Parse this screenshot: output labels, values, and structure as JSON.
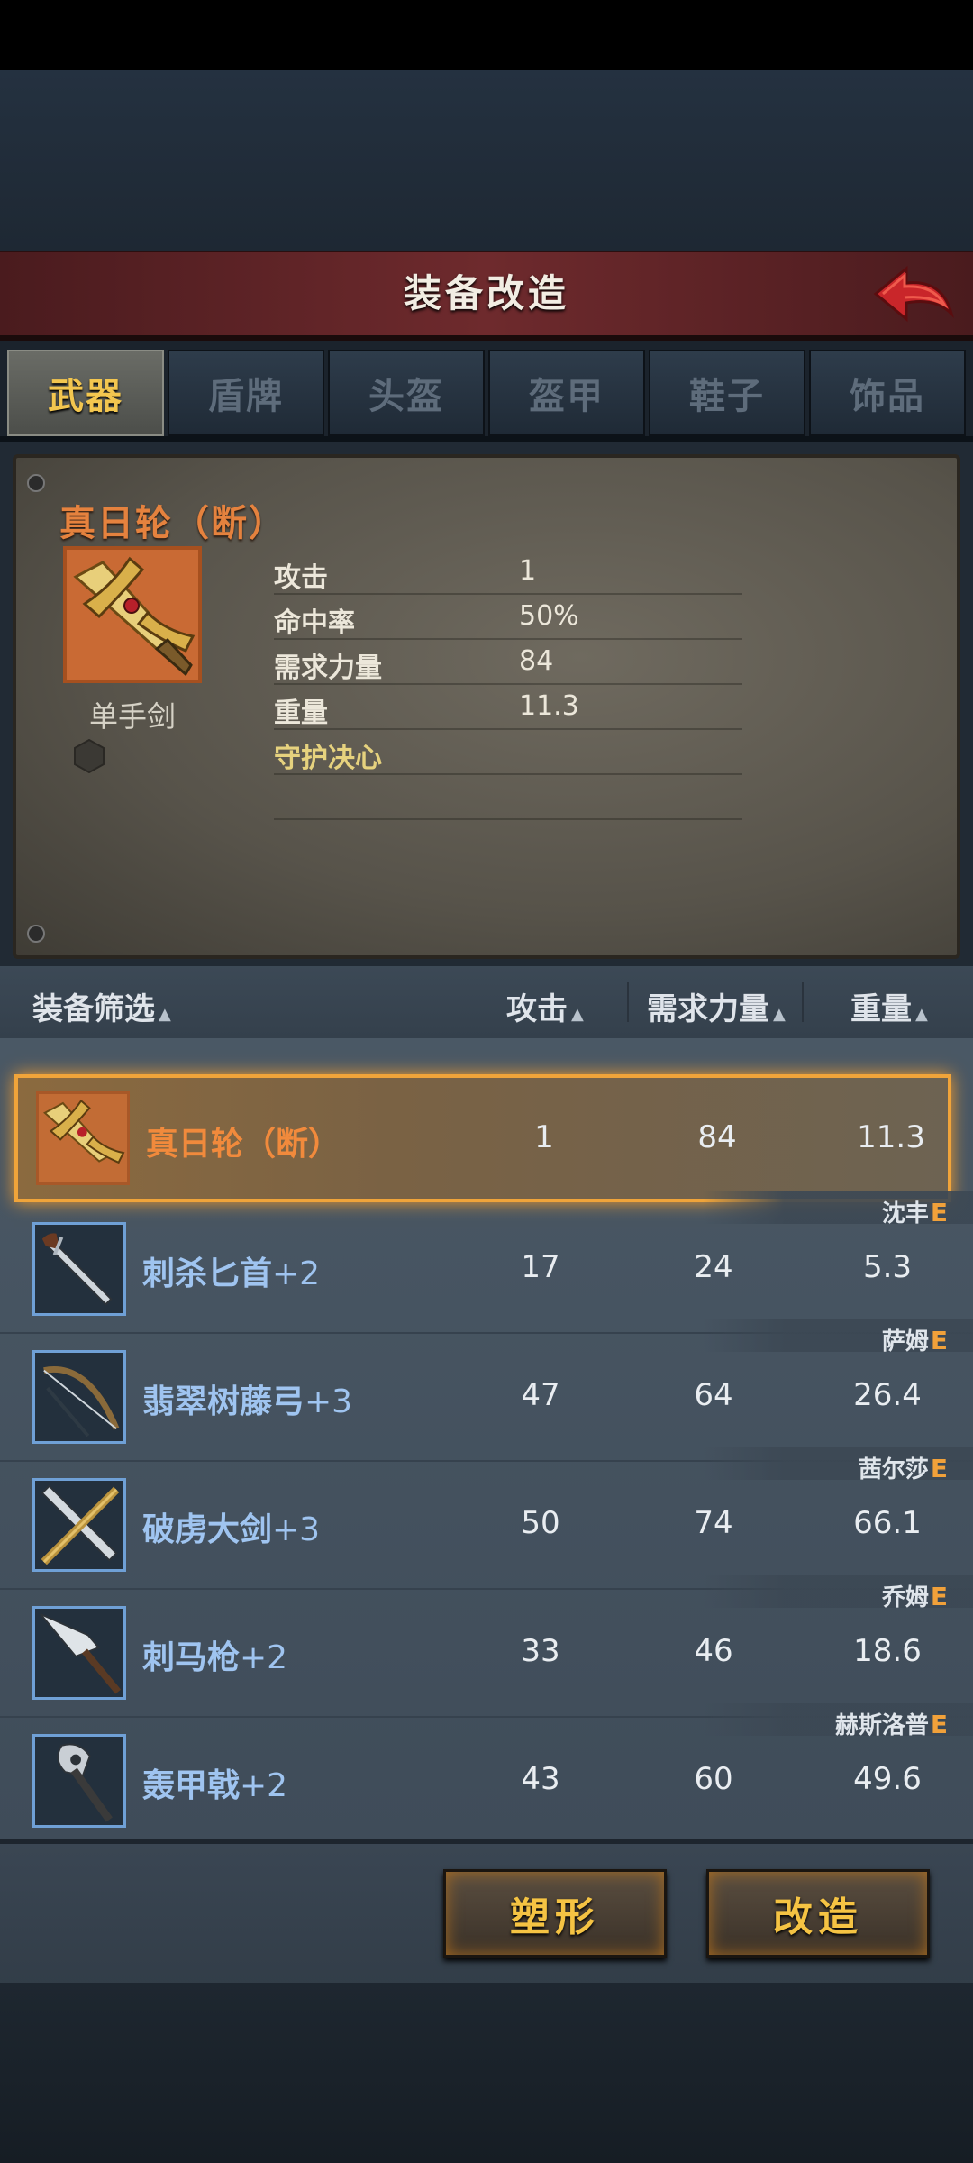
{
  "title": "装备改造",
  "tabs": [
    {
      "label": "武器",
      "active": true
    },
    {
      "label": "盾牌",
      "active": false
    },
    {
      "label": "头盔",
      "active": false
    },
    {
      "label": "盔甲",
      "active": false
    },
    {
      "label": "鞋子",
      "active": false
    },
    {
      "label": "饰品",
      "active": false
    }
  ],
  "item": {
    "name": "真日轮（断）",
    "type": "单手剑",
    "stats": [
      {
        "label": "攻击",
        "value": "1"
      },
      {
        "label": "命中率",
        "value": "50%"
      },
      {
        "label": "需求力量",
        "value": "84"
      },
      {
        "label": "重量",
        "value": "11.3"
      }
    ],
    "skill": "守护决心"
  },
  "list_header": {
    "filter": "装备筛选",
    "attack": "攻击",
    "strength": "需求力量",
    "weight": "重量",
    "sort_glyph": "▲"
  },
  "rows": [
    {
      "name": "真日轮（断）",
      "plus": "",
      "attack": "1",
      "strength": "84",
      "weight": "11.3",
      "owner": "",
      "grade": "",
      "selected": true,
      "icon": "sword-icon"
    },
    {
      "name": "刺杀匕首",
      "plus": "+2",
      "attack": "17",
      "strength": "24",
      "weight": "5.3",
      "owner": "沈丰",
      "grade": "E",
      "selected": false,
      "icon": "dagger-icon"
    },
    {
      "name": "翡翠树藤弓",
      "plus": "+3",
      "attack": "47",
      "strength": "64",
      "weight": "26.4",
      "owner": "萨姆",
      "grade": "E",
      "selected": false,
      "icon": "bow-icon"
    },
    {
      "name": "破虏大剑",
      "plus": "+3",
      "attack": "50",
      "strength": "74",
      "weight": "66.1",
      "owner": "茜尔莎",
      "grade": "E",
      "selected": false,
      "icon": "greatsword-icon"
    },
    {
      "name": "刺马枪",
      "plus": "+2",
      "attack": "33",
      "strength": "46",
      "weight": "18.6",
      "owner": "乔姆",
      "grade": "E",
      "selected": false,
      "icon": "spear-icon"
    },
    {
      "name": "轰甲戟",
      "plus": "+2",
      "attack": "43",
      "strength": "60",
      "weight": "49.6",
      "owner": "赫斯洛普",
      "grade": "E",
      "selected": false,
      "icon": "halberd-icon"
    }
  ],
  "buttons": {
    "reshape": "塑形",
    "modify": "改造"
  },
  "colors": {
    "accent_gold": "#f5c343",
    "item_name_orange": "#e5823e",
    "owned_item_blue": "#9fc4f0",
    "selection_border": "#f0a43a"
  }
}
